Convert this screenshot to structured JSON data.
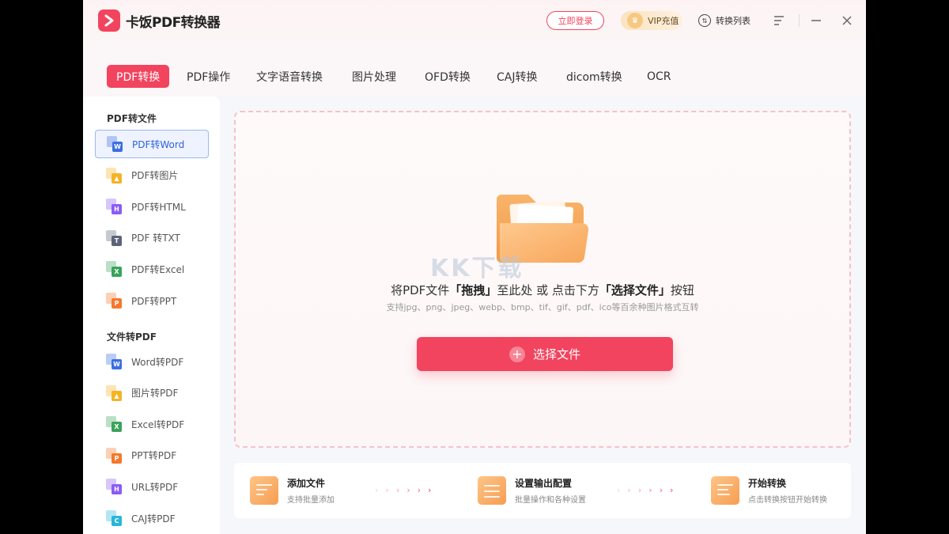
{
  "app": {
    "title": "卡饭PDF转换器"
  },
  "header": {
    "login_label": "立即登录",
    "vip_label": "VIP充值",
    "convert_list_label": "转换列表"
  },
  "tabs": [
    {
      "label": "PDF转换",
      "active": true
    },
    {
      "label": "PDF操作"
    },
    {
      "label": "文字语音转换"
    },
    {
      "label": "图片处理"
    },
    {
      "label": "OFD转换"
    },
    {
      "label": "CAJ转换"
    },
    {
      "label": "dicom转换"
    },
    {
      "label": "OCR"
    }
  ],
  "sidebar": {
    "section1_title": "PDF转文件",
    "section2_title": "文件转PDF",
    "items1": [
      {
        "label": "PDF转Word",
        "badge": "W",
        "color": "#3b6fe0",
        "icon": "word-file-icon",
        "active": true
      },
      {
        "label": "PDF转图片",
        "badge": "▲",
        "color": "#f5b324",
        "icon": "image-file-icon"
      },
      {
        "label": "PDF转HTML",
        "badge": "H",
        "color": "#8a5cf6",
        "icon": "html-file-icon"
      },
      {
        "label": "PDF 转TXT",
        "badge": "T",
        "color": "#5b6478",
        "icon": "txt-file-icon"
      },
      {
        "label": "PDF转Excel",
        "badge": "X",
        "color": "#3aa35c",
        "icon": "excel-file-icon"
      },
      {
        "label": "PDF转PPT",
        "badge": "P",
        "color": "#f5782c",
        "icon": "ppt-file-icon"
      }
    ],
    "items2": [
      {
        "label": "Word转PDF",
        "badge": "W",
        "color": "#3b6fe0",
        "icon": "word-file-icon"
      },
      {
        "label": "图片转PDF",
        "badge": "▲",
        "color": "#f5b324",
        "icon": "image-file-icon"
      },
      {
        "label": "Excel转PDF",
        "badge": "X",
        "color": "#3aa35c",
        "icon": "excel-file-icon"
      },
      {
        "label": "PPT转PDF",
        "badge": "P",
        "color": "#f5782c",
        "icon": "ppt-file-icon"
      },
      {
        "label": "URL转PDF",
        "badge": "H",
        "color": "#8a5cf6",
        "icon": "url-file-icon"
      },
      {
        "label": "CAJ转PDF",
        "badge": "C",
        "color": "#29b6d8",
        "icon": "caj-file-icon"
      }
    ]
  },
  "dropzone": {
    "text_pre": "将PDF文件",
    "text_drag": "「拖拽」",
    "text_mid": "至此处 或 点击下方",
    "text_select": "「选择文件」",
    "text_post": "按钮",
    "sub": "支持jpg、png、jpeg、webp、bmp、tif、gif、pdf、ico等百余种图片格式互转",
    "button_label": "选择文件",
    "watermark": "KK下载"
  },
  "steps": [
    {
      "title": "添加文件",
      "desc": "支持批量添加"
    },
    {
      "title": "设置输出配置",
      "desc": "批量操作和各种设置"
    },
    {
      "title": "开始转换",
      "desc": "点击转换按钮开始转换"
    }
  ],
  "colors": {
    "accent": "#f2445e",
    "active_blue": "#2f63d8"
  }
}
